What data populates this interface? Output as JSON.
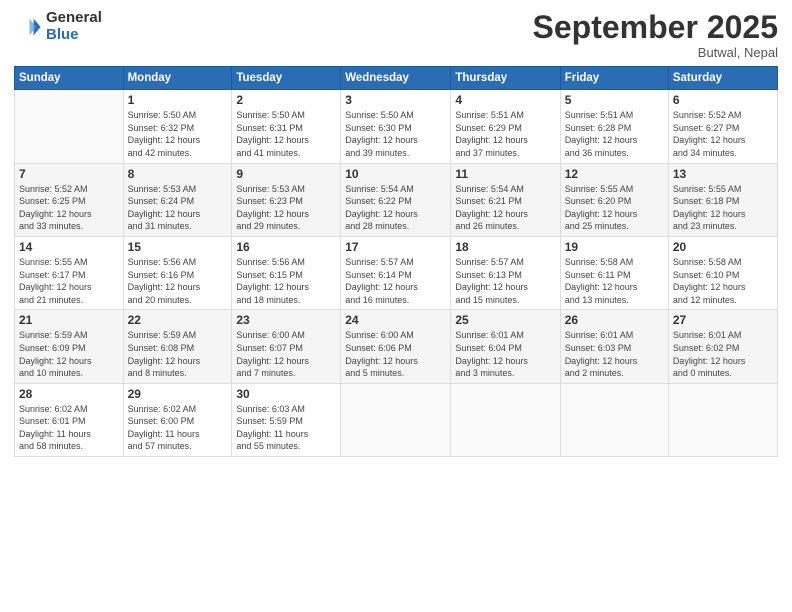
{
  "logo": {
    "general": "General",
    "blue": "Blue"
  },
  "header": {
    "month": "September 2025",
    "location": "Butwal, Nepal"
  },
  "weekdays": [
    "Sunday",
    "Monday",
    "Tuesday",
    "Wednesday",
    "Thursday",
    "Friday",
    "Saturday"
  ],
  "weeks": [
    [
      {
        "num": "",
        "info": ""
      },
      {
        "num": "1",
        "info": "Sunrise: 5:50 AM\nSunset: 6:32 PM\nDaylight: 12 hours\nand 42 minutes."
      },
      {
        "num": "2",
        "info": "Sunrise: 5:50 AM\nSunset: 6:31 PM\nDaylight: 12 hours\nand 41 minutes."
      },
      {
        "num": "3",
        "info": "Sunrise: 5:50 AM\nSunset: 6:30 PM\nDaylight: 12 hours\nand 39 minutes."
      },
      {
        "num": "4",
        "info": "Sunrise: 5:51 AM\nSunset: 6:29 PM\nDaylight: 12 hours\nand 37 minutes."
      },
      {
        "num": "5",
        "info": "Sunrise: 5:51 AM\nSunset: 6:28 PM\nDaylight: 12 hours\nand 36 minutes."
      },
      {
        "num": "6",
        "info": "Sunrise: 5:52 AM\nSunset: 6:27 PM\nDaylight: 12 hours\nand 34 minutes."
      }
    ],
    [
      {
        "num": "7",
        "info": "Sunrise: 5:52 AM\nSunset: 6:25 PM\nDaylight: 12 hours\nand 33 minutes."
      },
      {
        "num": "8",
        "info": "Sunrise: 5:53 AM\nSunset: 6:24 PM\nDaylight: 12 hours\nand 31 minutes."
      },
      {
        "num": "9",
        "info": "Sunrise: 5:53 AM\nSunset: 6:23 PM\nDaylight: 12 hours\nand 29 minutes."
      },
      {
        "num": "10",
        "info": "Sunrise: 5:54 AM\nSunset: 6:22 PM\nDaylight: 12 hours\nand 28 minutes."
      },
      {
        "num": "11",
        "info": "Sunrise: 5:54 AM\nSunset: 6:21 PM\nDaylight: 12 hours\nand 26 minutes."
      },
      {
        "num": "12",
        "info": "Sunrise: 5:55 AM\nSunset: 6:20 PM\nDaylight: 12 hours\nand 25 minutes."
      },
      {
        "num": "13",
        "info": "Sunrise: 5:55 AM\nSunset: 6:18 PM\nDaylight: 12 hours\nand 23 minutes."
      }
    ],
    [
      {
        "num": "14",
        "info": "Sunrise: 5:55 AM\nSunset: 6:17 PM\nDaylight: 12 hours\nand 21 minutes."
      },
      {
        "num": "15",
        "info": "Sunrise: 5:56 AM\nSunset: 6:16 PM\nDaylight: 12 hours\nand 20 minutes."
      },
      {
        "num": "16",
        "info": "Sunrise: 5:56 AM\nSunset: 6:15 PM\nDaylight: 12 hours\nand 18 minutes."
      },
      {
        "num": "17",
        "info": "Sunrise: 5:57 AM\nSunset: 6:14 PM\nDaylight: 12 hours\nand 16 minutes."
      },
      {
        "num": "18",
        "info": "Sunrise: 5:57 AM\nSunset: 6:13 PM\nDaylight: 12 hours\nand 15 minutes."
      },
      {
        "num": "19",
        "info": "Sunrise: 5:58 AM\nSunset: 6:11 PM\nDaylight: 12 hours\nand 13 minutes."
      },
      {
        "num": "20",
        "info": "Sunrise: 5:58 AM\nSunset: 6:10 PM\nDaylight: 12 hours\nand 12 minutes."
      }
    ],
    [
      {
        "num": "21",
        "info": "Sunrise: 5:59 AM\nSunset: 6:09 PM\nDaylight: 12 hours\nand 10 minutes."
      },
      {
        "num": "22",
        "info": "Sunrise: 5:59 AM\nSunset: 6:08 PM\nDaylight: 12 hours\nand 8 minutes."
      },
      {
        "num": "23",
        "info": "Sunrise: 6:00 AM\nSunset: 6:07 PM\nDaylight: 12 hours\nand 7 minutes."
      },
      {
        "num": "24",
        "info": "Sunrise: 6:00 AM\nSunset: 6:06 PM\nDaylight: 12 hours\nand 5 minutes."
      },
      {
        "num": "25",
        "info": "Sunrise: 6:01 AM\nSunset: 6:04 PM\nDaylight: 12 hours\nand 3 minutes."
      },
      {
        "num": "26",
        "info": "Sunrise: 6:01 AM\nSunset: 6:03 PM\nDaylight: 12 hours\nand 2 minutes."
      },
      {
        "num": "27",
        "info": "Sunrise: 6:01 AM\nSunset: 6:02 PM\nDaylight: 12 hours\nand 0 minutes."
      }
    ],
    [
      {
        "num": "28",
        "info": "Sunrise: 6:02 AM\nSunset: 6:01 PM\nDaylight: 11 hours\nand 58 minutes."
      },
      {
        "num": "29",
        "info": "Sunrise: 6:02 AM\nSunset: 6:00 PM\nDaylight: 11 hours\nand 57 minutes."
      },
      {
        "num": "30",
        "info": "Sunrise: 6:03 AM\nSunset: 5:59 PM\nDaylight: 11 hours\nand 55 minutes."
      },
      {
        "num": "",
        "info": ""
      },
      {
        "num": "",
        "info": ""
      },
      {
        "num": "",
        "info": ""
      },
      {
        "num": "",
        "info": ""
      }
    ]
  ]
}
